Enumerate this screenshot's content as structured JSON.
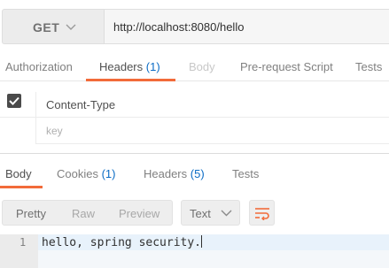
{
  "request": {
    "method": "GET",
    "url": "http://localhost:8080/hello"
  },
  "request_tabs": [
    {
      "label": "Authorization",
      "count": null,
      "state": "normal"
    },
    {
      "label": "Headers",
      "count": "(1)",
      "state": "active"
    },
    {
      "label": "Body",
      "count": null,
      "state": "disabled"
    },
    {
      "label": "Pre-request Script",
      "count": null,
      "state": "normal"
    },
    {
      "label": "Tests",
      "count": null,
      "state": "normal"
    }
  ],
  "headers": {
    "rows": [
      {
        "checked": true,
        "key": "Content-Type"
      }
    ],
    "key_placeholder": "key"
  },
  "response_tabs": [
    {
      "label": "Body",
      "count": null,
      "state": "active"
    },
    {
      "label": "Cookies",
      "count": "(1)",
      "state": "normal"
    },
    {
      "label": "Headers",
      "count": "(5)",
      "state": "normal"
    },
    {
      "label": "Tests",
      "count": null,
      "state": "normal"
    }
  ],
  "toolbar": {
    "view_modes": [
      "Pretty",
      "Raw",
      "Preview"
    ],
    "selected_view": "Pretty",
    "format": "Text",
    "wrap_icon": "wrap-lines-icon"
  },
  "response_body": {
    "lines": [
      {
        "number": "1",
        "text": "hello, spring security."
      }
    ]
  },
  "colors": {
    "accent": "#f26b3a",
    "count": "#0b6cc5"
  }
}
